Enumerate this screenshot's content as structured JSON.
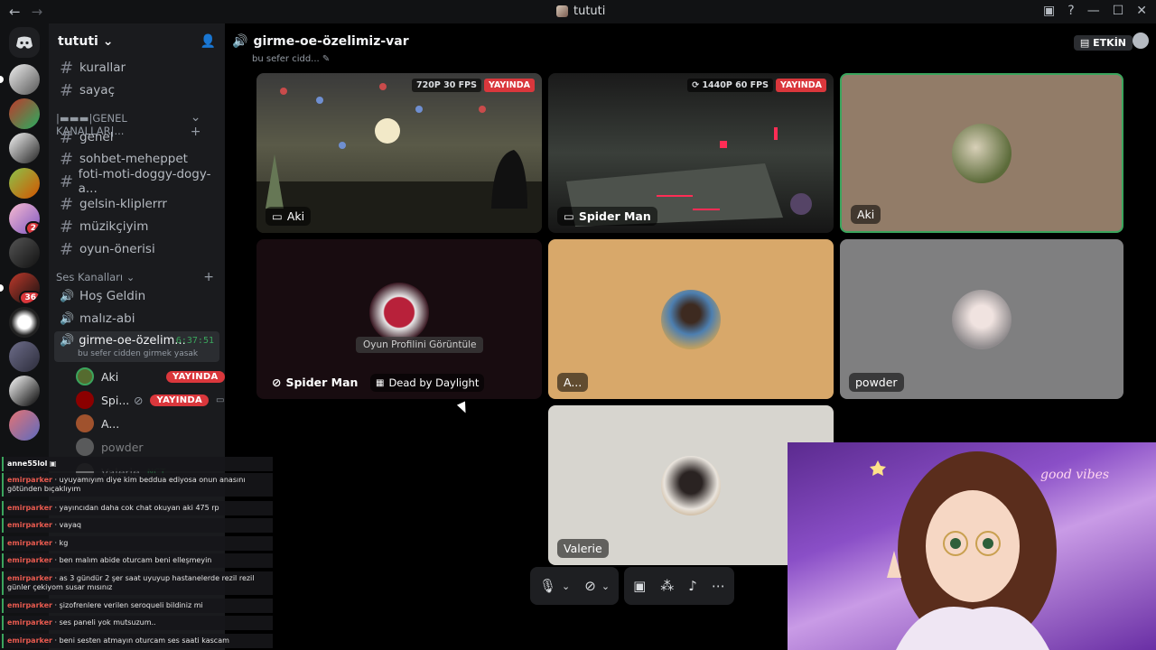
{
  "window": {
    "title": "tututi"
  },
  "guilds": [
    {
      "badge": ""
    },
    {
      "badge": ""
    },
    {
      "badge": ""
    },
    {
      "badge": ""
    },
    {
      "badge": "2"
    },
    {
      "badge": ""
    },
    {
      "badge": "36"
    },
    {
      "badge": ""
    },
    {
      "badge": ""
    },
    {
      "badge": ""
    },
    {
      "badge": ""
    }
  ],
  "server": {
    "name": "tututi"
  },
  "channels": {
    "top": [
      {
        "name": "kurallar"
      },
      {
        "name": "sayaç"
      }
    ],
    "category_general": "|▬▬▬|GENEL KANALLAR|...",
    "general": [
      {
        "name": "genel"
      },
      {
        "name": "sohbet-meheppet"
      },
      {
        "name": "foti-moti-doggy-dogy-a..."
      },
      {
        "name": "gelsin-kliplerrr"
      },
      {
        "name": "müzikçiyim"
      },
      {
        "name": "oyun-önerisi"
      }
    ],
    "category_voice": "Ses Kanalları",
    "voice": [
      {
        "name": "Hoş Geldin"
      },
      {
        "name": "malız-abi"
      }
    ],
    "active_voice": {
      "name": "girme-oe-özelim...",
      "timer": "6:37:51",
      "status": "bu sefer cidden girmek yasak"
    },
    "voice_users": [
      {
        "name": "Aki",
        "live": "YAYINDA"
      },
      {
        "name": "Spi...",
        "live": "YAYINDA"
      },
      {
        "name": "A...",
        "live": ""
      },
      {
        "name": "powder",
        "live": ""
      },
      {
        "name": "Valerie",
        "live": "NCT"
      }
    ]
  },
  "voice_header": {
    "name": "girme-oe-özelimiz-var",
    "subtitle": "bu sefer cidd...",
    "activity": "ETKİN"
  },
  "tiles": [
    {
      "name": "Aki",
      "fps": "720P 30 FPS",
      "live": "YAYINDA"
    },
    {
      "name": "Spider Man",
      "fps": "1440P 60 FPS",
      "live": "YAYINDA"
    },
    {
      "name": "Aki",
      "fps": "",
      "live": ""
    },
    {
      "name": "Spider Man",
      "game": "Dead by Daylight",
      "overlay": "Oyun Profilini Görüntüle"
    },
    {
      "name": "A..."
    },
    {
      "name": "powder"
    },
    {
      "name": "Valerie"
    }
  ],
  "chat": [
    {
      "user": "anne55lol",
      "text": ""
    },
    {
      "user": "emirparker",
      "text": "uyuyamıyım diye kim beddua ediyosa onun anasını götünden bıçaklıyım"
    },
    {
      "user": "emirparker",
      "text": "yayıncıdan daha cok chat okuyan aki 475 rp"
    },
    {
      "user": "emirparker",
      "text": "vayaq"
    },
    {
      "user": "emirparker",
      "text": "kg"
    },
    {
      "user": "emirparker",
      "text": "ben malım abide oturcam beni elleşmeyin"
    },
    {
      "user": "emirparker",
      "text": "as 3 gündür 2 şer saat uyuyup hastanelerde rezil rezil günler çekiyom susar mısınız"
    },
    {
      "user": "emirparker",
      "text": "şizofrenlere verilen seroqueli bildiniz mi"
    },
    {
      "user": "emirparker",
      "text": "ses paneli yok mutsuzum.."
    },
    {
      "user": "emirparker",
      "text": "beni sesten atmayın oturcam ses saati kascam"
    }
  ],
  "colors": {
    "live": "#da373c",
    "speaking": "#3ba55d",
    "bg": "#000000"
  }
}
